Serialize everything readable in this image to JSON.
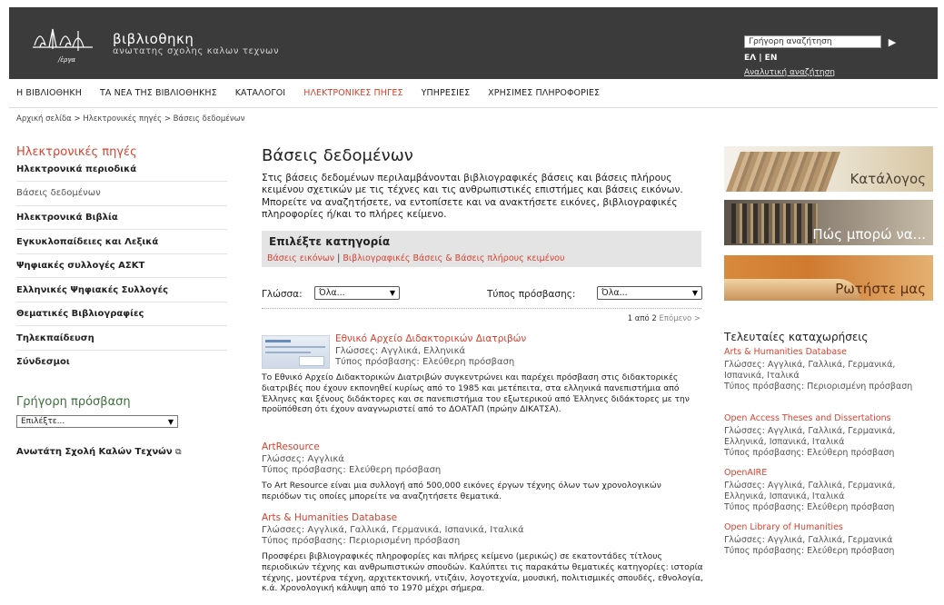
{
  "header": {
    "site_title": "βιβλιοθηκη",
    "site_subtitle": "ανωτατης σχολης καλων τεχνων",
    "logo_text": "/ἐργα",
    "search_value": "Γρήγορη αναζήτηση",
    "lang": "ΕΛ | EN",
    "advanced_search": "Αναλυτική αναζήτηση"
  },
  "nav": [
    "Η ΒΙΒΛΙΟΘΗΚΗ",
    "ΤΑ ΝΕΑ ΤΗΣ ΒΙΒΛΙΟΘΗΚΗΣ",
    "ΚΑΤΑΛΟΓΟΙ",
    "ΗΛΕΚΤΡΟΝΙΚΕΣ ΠΗΓΕΣ",
    "ΥΠΗΡΕΣΙΕΣ",
    "ΧΡΗΣΙΜΕΣ ΠΛΗΡΟΦΟΡΙΕΣ"
  ],
  "breadcrumb": {
    "home": "Αρχική σελίδα",
    "sep": ">",
    "section": "Ηλεκτρονικές πηγές",
    "current": "Βάσεις δεδομένων"
  },
  "sidebar": {
    "title": "Ηλεκτρονικές πηγές",
    "items": [
      "Ηλεκτρονικά περιοδικά",
      "Βάσεις δεδομένων",
      "Ηλεκτρονικά Βιβλία",
      "Εγκυκλοπαίδειες και Λεξικά",
      "Ψηφιακές συλλογές ΑΣΚΤ",
      "Ελληνικές Ψηφιακές Συλλογές",
      "Θεματικές Βιβλιογραφίες",
      "Τηλεκπαίδευση",
      "Σύνδεσμοι"
    ],
    "quick_title": "Γρήγορη πρόσβαση",
    "quick_select": "Επιλέξτε...",
    "askt_link": "Ανωτάτη Σχολή Καλών Τεχνών"
  },
  "main": {
    "title": "Βάσεις δεδομένων",
    "intro": "Στις βάσεις δεδομένων περιλαμβάνονται βιβλιογραφικές βάσεις και βάσεις πλήρους κειμένου σχετικών με τις τέχνες και τις ανθρωπιστικές επιστήμες και βάσεις εικόνων. Μπορείτε να αναζητήσετε, να εντοπίσετε και να ανακτήσετε εικόνες, βιβλιογραφικές πληροφορίες ή/και το πλήρες κείμενο.",
    "category_title": "Επιλέξτε κατηγορία",
    "category_1": "Βάσεις εικόνων",
    "category_sep": "|",
    "category_2": "Βιβλιογραφικές Βάσεις & Βάσεις πλήρους κειμένου",
    "lang_label": "Γλώσσα:",
    "lang_value": "Όλα...",
    "access_label": "Τύπος πρόσβασης:",
    "access_value": "Όλα...",
    "pager": "1 από 2",
    "pager_next": "Επόμενο >",
    "entries": [
      {
        "title": "Εθνικό Αρχείο Διδακτορικών Διατριβών",
        "languages": "Γλώσσες: Αγγλικά, Ελληνικά",
        "access": "Τύπος πρόσβασης: Ελεύθερη πρόσβαση",
        "desc": "Το Εθνικό Αρχείο Διδακτορικών Διατριβών συγκεντρώνει και παρέχει πρόσβαση στις διδακτορικές διατριβές που έχουν εκπονηθεί κυρίως από το 1985 και μετέπειτα, στα ελληνικά πανεπιστήμια από Έλληνες και ξένους διδάκτορες και σε πανεπιστήμια του εξωτερικού από Έλληνες διδάκτορες με την προϋπόθεση ότι έχουν αναγνωριστεί από το ΔΟΑΤΑΠ (πρώην ΔΙΚΑΤΣΑ)."
      },
      {
        "title": "ArtResource",
        "languages": "Γλώσσες: Αγγλικά",
        "access": "Τύπος πρόσβασης: Ελεύθερη πρόσβαση",
        "desc": "Το Art Resource είναι μια συλλογή από 500,000 εικόνες έργων τέχνης όλων των χρονολογικών περιόδων τις οποίες μπορείτε να αναζητήσετε θεματικά."
      },
      {
        "title": "Arts & Humanities Database",
        "languages": "Γλώσσες: Αγγλικά, Γαλλικά, Γερμανικά, Ισπανικά, Ιταλικά",
        "access": "Τύπος πρόσβασης: Περιορισμένη πρόσβαση",
        "desc": "Προσφέρει βιβλιογραφικές πληροφορίες και πλήρες κείμενο (μερικώς) σε εκατοντάδες τίτλους περιοδικών τέχνης και ανθρωπιστικών σπουδών. Καλύπτει τις παρακάτω θεματικές κατηγορίες: ιστορία τέχνης, μοντέρνα τέχνη, αρχιτεκτονική, ντιζάιν, λογοτεχνία, μουσική, πολιτισμικές σπουδές, εθνολογία, κ.ά. Χρονολογική κάλυψη από το 1970 μέχρι σήμερα."
      }
    ]
  },
  "right": {
    "promo_1": "Κατάλογος",
    "promo_2": "Πώς μπορώ να...",
    "promo_3": "Ρωτήστε μας",
    "recent_title": "Τελευταίες καταχωρήσεις",
    "recent": [
      {
        "title": "Arts & Humanities Database",
        "meta": "Γλώσσες: Αγγλικά, Γαλλικά, Γερμανικά, Ισπανικά, Ιταλικά",
        "access": "Τύπος πρόσβασης: Περιορισμένη πρόσβαση"
      },
      {
        "title": "Open Access Theses and Dissertations",
        "meta": "Γλώσσες: Αγγλικά, Γαλλικά, Γερμανικά, Ελληνικά, Ισπανικά, Ιταλικά",
        "access": "Τύπος πρόσβασης: Ελεύθερη πρόσβαση"
      },
      {
        "title": "OpenAIRE",
        "meta": "Γλώσσες: Αγγλικά, Γαλλικά, Γερμανικά, Ελληνικά, Ισπανικά, Ιταλικά",
        "access": "Τύπος πρόσβασης: Ελεύθερη πρόσβαση"
      },
      {
        "title": "Open Library of Humanities",
        "meta": "Γλώσσες: Αγγλικά, Γαλλικά, Γερμανικά",
        "access": "Τύπος πρόσβασης: Ελεύθερη πρόσβαση"
      }
    ]
  },
  "colors": {
    "accent": "#d9412f",
    "header_bg": "#3b3b3b",
    "quick_access": "#3c6e3c"
  },
  "icons": {
    "search_go": "play-arrow-icon",
    "select_chevron": "chevron-down-icon",
    "external": "external-link-icon"
  }
}
